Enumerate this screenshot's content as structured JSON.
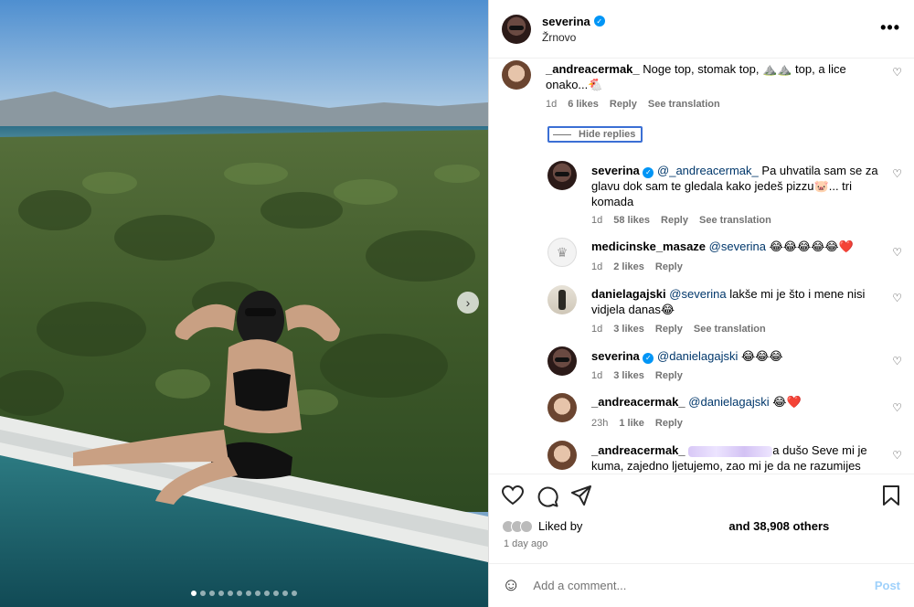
{
  "post": {
    "username": "severina",
    "location": "Žrnovo",
    "more_icon": "more-horizontal-icon",
    "carousel_next": "›",
    "carousel_count": 12,
    "carousel_active": 0
  },
  "comments": [
    {
      "username": "_andreacermak_",
      "text": "Noge top, stomak top, ⛰️⛰️ top, a lice onako...🐔",
      "age": "1d",
      "likes": "6 likes",
      "reply": "Reply",
      "translate": "See translation",
      "hide_replies": "Hide replies"
    }
  ],
  "replies": [
    {
      "username": "severina",
      "mention": "@_andreacermak_",
      "text": "Pa uhvatila sam se za glavu dok sam te gledala kako jedeš pizzu🐷... tri komada",
      "age": "1d",
      "likes": "58 likes",
      "reply": "Reply",
      "translate": "See translation"
    },
    {
      "username": "medicinske_masaze",
      "mention": "@severina",
      "text": "😂😂😂😂😂❤️",
      "age": "1d",
      "likes": "2 likes",
      "reply": "Reply"
    },
    {
      "username": "danielagajski",
      "mention": "@severina",
      "text": "lakše mi je što i mene nisi vidjela danas😂",
      "age": "1d",
      "likes": "3 likes",
      "reply": "Reply",
      "translate": "See translation"
    },
    {
      "username": "severina",
      "mention": "@danielagajski",
      "text": "😂😂😂",
      "age": "1d",
      "likes": "3 likes",
      "reply": "Reply"
    },
    {
      "username": "_andreacermak_",
      "mention": "@danielagajski",
      "text": "😂❤️",
      "age": "23h",
      "likes": "1 like",
      "reply": "Reply"
    },
    {
      "username": "_andreacermak_",
      "text_after_blur": "a dušo Seve mi je kuma, zajedno ljetujemo, zao mi je da ne razumijes"
    }
  ],
  "footer": {
    "liked_by": "Liked by",
    "others": "and 38,908 others",
    "time_ago": "1 day ago",
    "comment_placeholder": "Add a comment...",
    "post_label": "Post"
  },
  "colors": {
    "accent": "#0095f6",
    "post_disabled": "#9fd1fb",
    "mention": "#00376b",
    "meta": "#737373"
  }
}
